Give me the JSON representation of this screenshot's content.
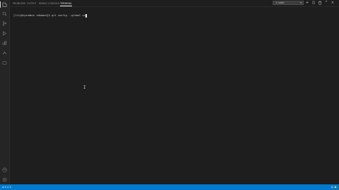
{
  "activity_bar": {
    "items": [
      "explorer-icon",
      "search-icon",
      "source-control-icon",
      "run-debug-icon",
      "extensions-icon",
      "remote-icon",
      "testing-icon"
    ],
    "bottom_items": [
      "account-icon",
      "settings-gear-icon"
    ]
  },
  "panel": {
    "tabs": [
      {
        "label": "PROBLEMS"
      },
      {
        "label": "OUTPUT"
      },
      {
        "label": "DEBUG CONSOLE"
      },
      {
        "label": "TERMINAL"
      }
    ],
    "terminal_select": "1: bash",
    "buttons": [
      "+",
      "◫",
      "🗑",
      "^",
      "×"
    ]
  },
  "terminal": {
    "prompt": "[lily@sysadmin sdkmand]$ git config --global co"
  },
  "status_bar": {
    "left": "⊗ 0 ⚠ 0",
    "right": "☺ 🔔"
  },
  "colors": {
    "status_bar": "#007acc",
    "background": "#1e1e1e"
  }
}
